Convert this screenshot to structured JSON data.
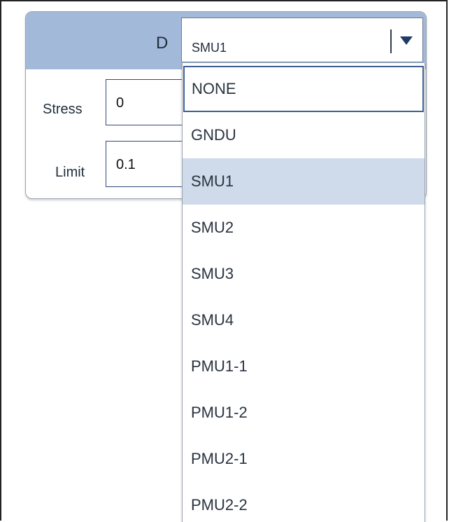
{
  "panel": {
    "terminal_label": "D",
    "select": {
      "value": "SMU1"
    },
    "fields": {
      "stress": {
        "label": "Stress",
        "value": "0"
      },
      "limit": {
        "label": "Limit",
        "value": "0.1"
      }
    }
  },
  "dropdown": {
    "options": [
      "NONE",
      "GNDU",
      "SMU1",
      "SMU2",
      "SMU3",
      "SMU4",
      "PMU1-1",
      "PMU1-2",
      "PMU2-1",
      "PMU2-2"
    ],
    "focused_option": "NONE",
    "selected_option": "SMU1"
  },
  "colors": {
    "header_bg": "#a3b9d9",
    "selected_option_bg": "#cfdaea",
    "border_accent": "#2f4a78"
  },
  "icons": {
    "select_arrow": "caret-down-icon"
  }
}
